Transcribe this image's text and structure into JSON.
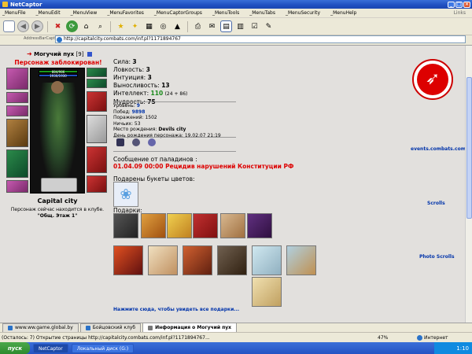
{
  "window": {
    "title": "NetCaptor"
  },
  "menu": {
    "items": [
      "_MenuFile",
      "_MenuEdit",
      "_MenuView",
      "_MenuFavorites",
      "_MenuCaptorGroups",
      "_MenuTools",
      "_MenuTabs",
      "_MenuSecurity",
      "_MenuHelp"
    ],
    "links": "Links"
  },
  "addressbar": {
    "caption": "AddressBarCaption",
    "url": "http://capitalcity.combats.com/inf.pl?1171894767"
  },
  "character": {
    "name": "Могучий пух",
    "level": "[9]",
    "blocked": "Персонаж заблокирован!",
    "hp": "884/986",
    "mp": "1930/1930",
    "city": "Capital city",
    "in_club": "Персонаж сейчас находится в клубе.",
    "floor": "\"Общ. Этаж 1\""
  },
  "stats": [
    {
      "label": "Сила:",
      "value": "3"
    },
    {
      "label": "Ловкость:",
      "value": "3"
    },
    {
      "label": "Интуиция:",
      "value": "3"
    },
    {
      "label": "Выносливость:",
      "value": "13"
    },
    {
      "label": "Интеллект:",
      "value": "110",
      "extra": "(24 + 86)"
    },
    {
      "label": "Мудрость:",
      "value": "75"
    }
  ],
  "info": {
    "level_label": "Уровень:",
    "level": "9",
    "wins_label": "Побед:",
    "wins": "9898",
    "losses_label": "Поражений:",
    "losses": "1502",
    "draws_label": "Ничьих:",
    "draws": "53",
    "birthplace_label": "Место рождения:",
    "birthplace": "Devils city",
    "birthday_label": "День рождения персонажа:",
    "birthday": "19.02.07 21:19"
  },
  "paladin": {
    "heading": "Сообщение от паладинов :",
    "message": "01.04.09 00:00 Рецидив нарушений Конституции РФ"
  },
  "bouquets": {
    "heading": "Подарены букеты цветов:"
  },
  "gifts": {
    "heading": "Подарки:",
    "more_link": "Нажмите сюда, чтобы увидеть все подарки..."
  },
  "right_links": {
    "events": "events.combats.com",
    "scrolls": "Scrolls",
    "photo_scrolls": "Photo Scrolls"
  },
  "tabs": [
    {
      "label": "www.ww.game.global.by"
    },
    {
      "label": "Бойцовский клуб"
    },
    {
      "label": "Информация о Могучий пух"
    }
  ],
  "status": {
    "text": "(Осталось: 7) Открытие страницы http://capitalcity.combats.com/inf.pl?1171894767...",
    "progress": "47%",
    "zone": "Интернет"
  },
  "taskbar": {
    "start": "пуск",
    "tasks": [
      "NetCaptor",
      "Локальный диск (G:)"
    ],
    "clock": "1:10"
  },
  "colors": {
    "blocked": "#dd0000",
    "link": "#0033aa",
    "taskbar": "#2453c4",
    "logo": "#dd0000"
  }
}
